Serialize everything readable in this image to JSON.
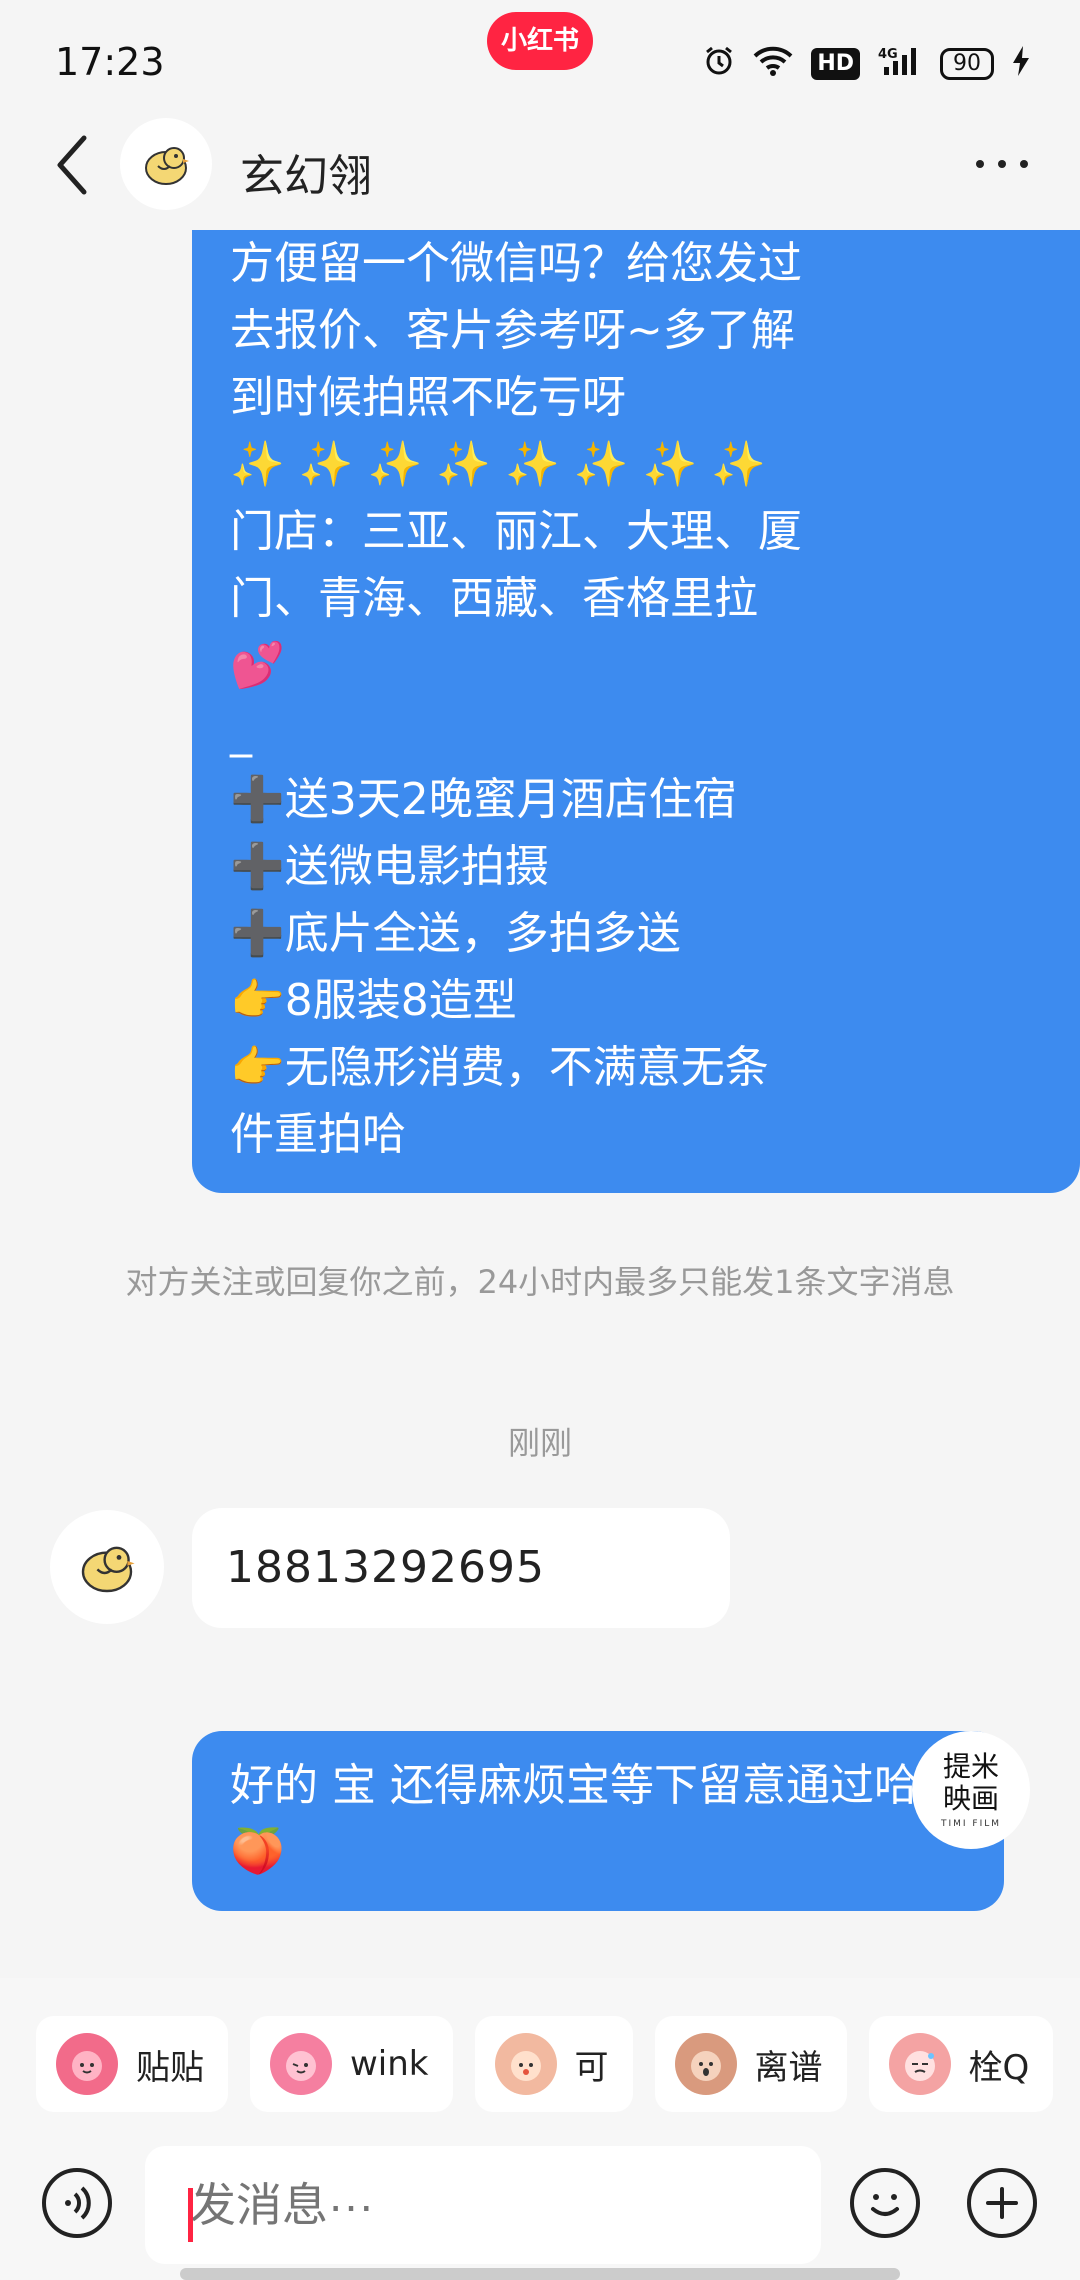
{
  "status_bar": {
    "time": "17:23",
    "app_badge": "小红书",
    "hd": "HD",
    "network": "4G",
    "battery": "90"
  },
  "header": {
    "contact_name": "玄幻翎"
  },
  "messages": {
    "m1_lines": [
      "方便留一个微信吗？给您发过",
      "去报价、客片参考呀~多了解",
      "到时候拍照不吃亏呀",
      "✨ ✨ ✨ ✨ ✨ ✨ ✨ ✨",
      "门店：三亚、丽江、大理、厦",
      "门、青海、西藏、香格里拉",
      "💕",
      "_",
      "➕送3天2晚蜜月酒店住宿",
      "➕送微电影拍摄",
      "➕底片全送，多拍多送",
      "👉8服装8造型",
      "👉无隐形消费，不满意无条",
      "件重拍哈"
    ],
    "system_notice": "对方关注或回复你之前，24小时内最多只能发1条文字消息",
    "timestamp": "刚刚",
    "m2": "18813292695",
    "m3": "好的  宝 还得麻烦宝等下留意通过哈🍑"
  },
  "sent_avatar": {
    "line1": "提米",
    "line2": "映画",
    "sub": "TIMI FILM"
  },
  "quick_replies": [
    {
      "label": "贴贴",
      "icon": "hug-sticker-icon",
      "color": "#f26b8a"
    },
    {
      "label": "wink",
      "icon": "wink-sticker-icon",
      "color": "#f57fa0"
    },
    {
      "label": "可",
      "icon": "ok-sticker-icon",
      "color": "#f2b9a0"
    },
    {
      "label": "离谱",
      "icon": "shocked-sticker-icon",
      "color": "#d99a7e"
    },
    {
      "label": "栓Q",
      "icon": "thanks-sticker-icon",
      "color": "#f4a3a3"
    }
  ],
  "input": {
    "placeholder": "发消息···"
  }
}
